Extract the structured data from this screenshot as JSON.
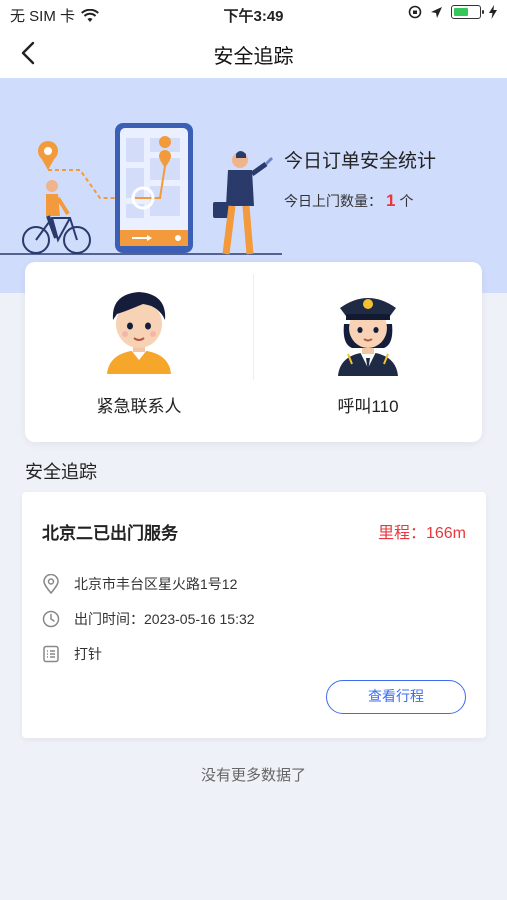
{
  "status_bar": {
    "carrier": "无 SIM 卡",
    "time": "下午3:49"
  },
  "nav": {
    "title": "安全追踪"
  },
  "banner": {
    "stats_title": "今日订单安全统计",
    "visits_label": "今日上门数量：",
    "visits_count": "1",
    "visits_unit": "个"
  },
  "contacts": {
    "emergency_label": "紧急联系人",
    "police_label": "呼叫110"
  },
  "section": {
    "title": "安全追踪"
  },
  "order": {
    "title": "北京二已出门服务",
    "distance": "里程：166m",
    "address": "北京市丰台区星火路1号12",
    "depart_time": "出门时间：2023-05-16 15:32",
    "clock_in": "打针",
    "view_button": "查看行程"
  },
  "footer": {
    "no_more": "没有更多数据了"
  },
  "colors": {
    "accent_blue": "#3d6cf0",
    "accent_red": "#e8383d",
    "banner_bg": "#cfdcfb",
    "page_bg": "#eef1f7"
  }
}
